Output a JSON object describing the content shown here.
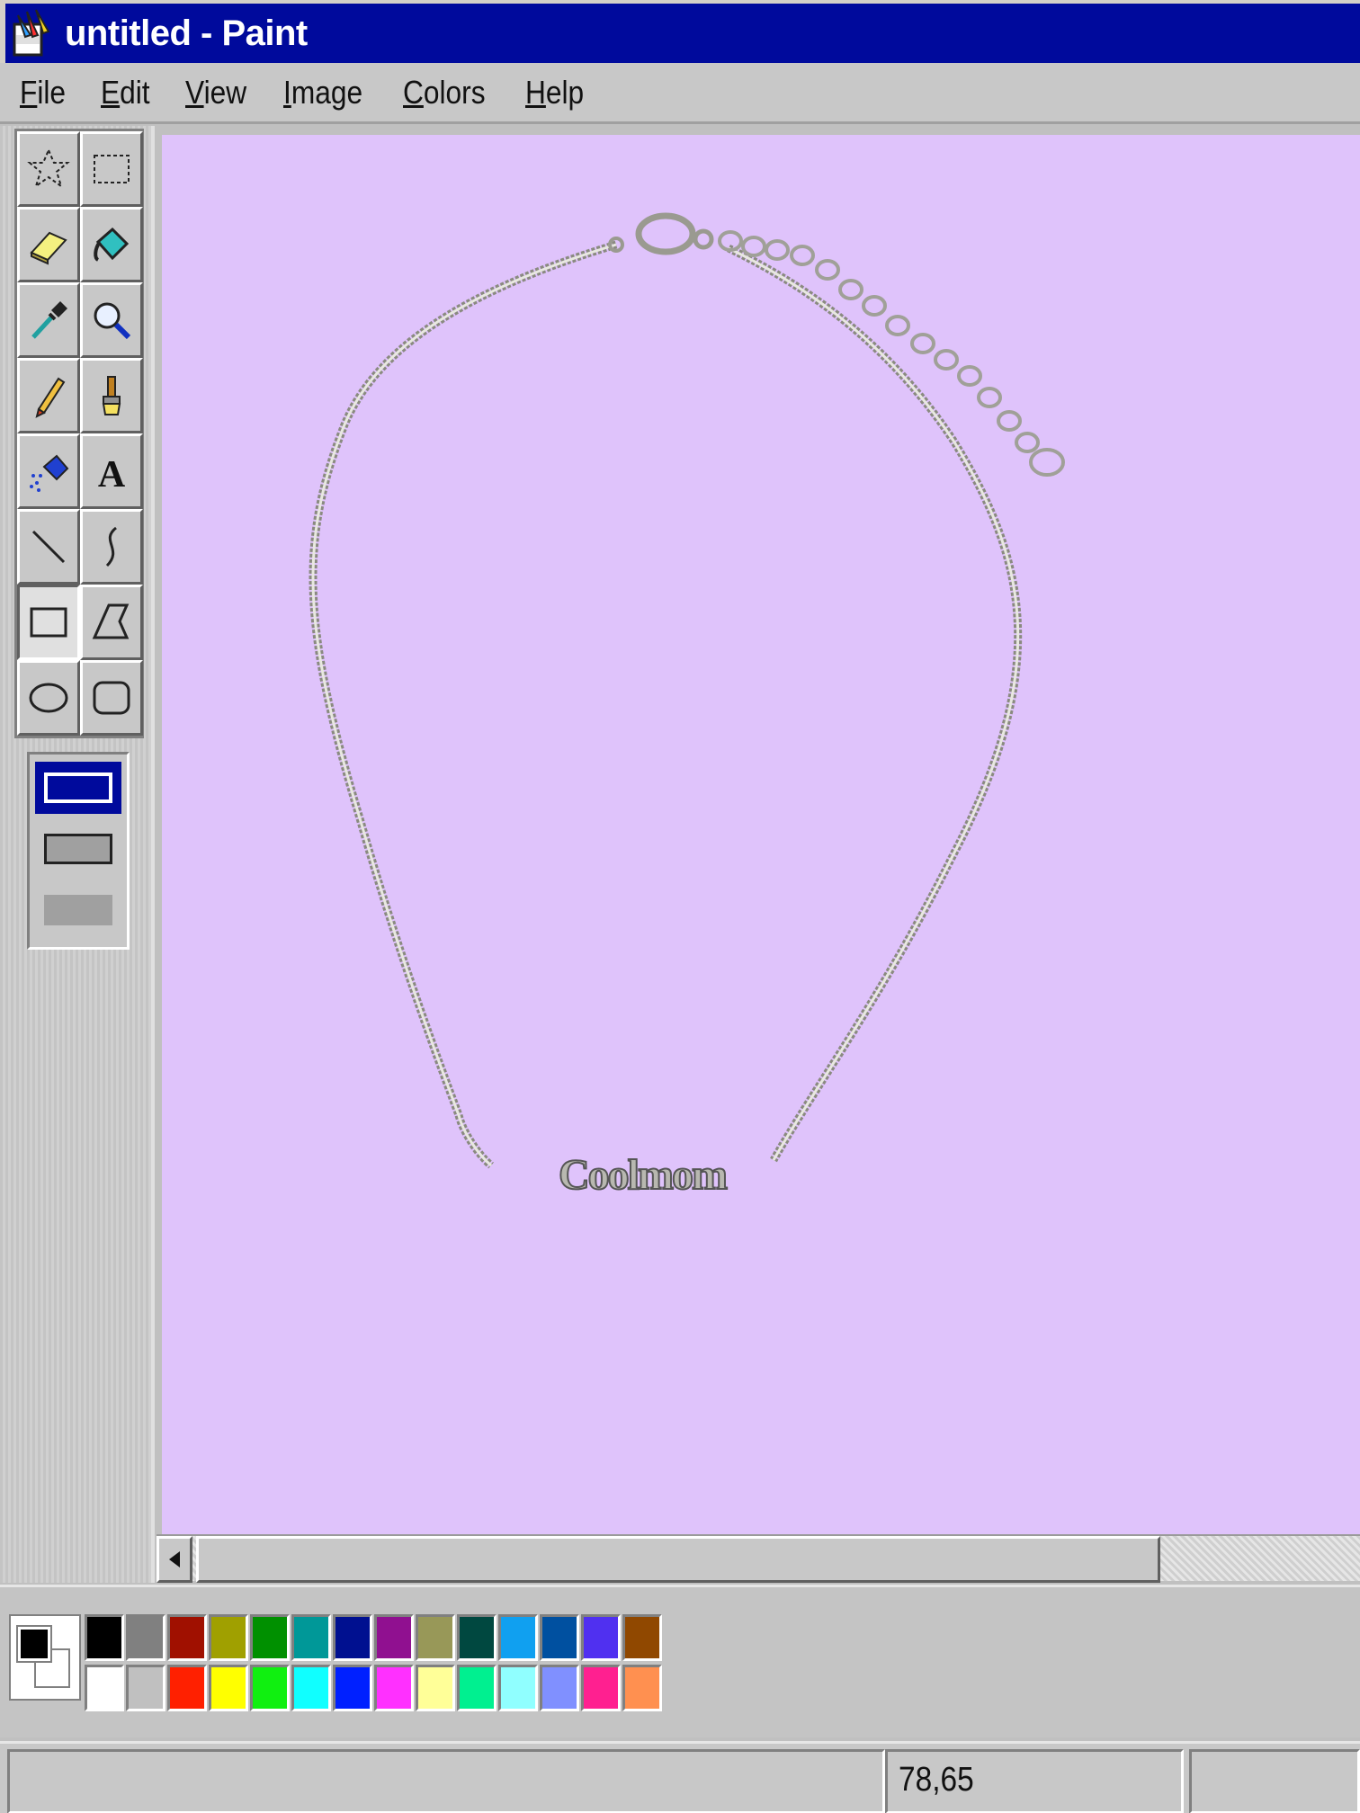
{
  "window": {
    "title": "untitled - Paint"
  },
  "menu": [
    {
      "label": "File",
      "accel": "F",
      "rest": "ile"
    },
    {
      "label": "Edit",
      "accel": "E",
      "rest": "dit"
    },
    {
      "label": "View",
      "accel": "V",
      "rest": "iew"
    },
    {
      "label": "Image",
      "accel": "I",
      "rest": "mage"
    },
    {
      "label": "Colors",
      "accel": "C",
      "rest": "olors"
    },
    {
      "label": "Help",
      "accel": "H",
      "rest": "elp"
    }
  ],
  "tools": [
    "free-form-select-icon",
    "select-icon",
    "eraser-icon",
    "fill-icon",
    "pick-color-icon",
    "magnifier-icon",
    "pencil-icon",
    "brush-icon",
    "airbrush-icon",
    "text-icon",
    "line-icon",
    "curve-icon",
    "rectangle-icon",
    "polygon-icon",
    "ellipse-icon",
    "rounded-rectangle-icon"
  ],
  "active_tool": "rectangle-icon",
  "canvas": {
    "background": "#dfc3fb",
    "pendant_text": "Coolmom"
  },
  "palette": {
    "foreground": "#000000",
    "background": "#ffffff",
    "top_row": [
      "#000000",
      "#808080",
      "#a01000",
      "#a0a000",
      "#009000",
      "#009898",
      "#001090",
      "#901090",
      "#989858",
      "#004840",
      "#10a0f0",
      "#0050a0",
      "#5030f0",
      "#904800"
    ],
    "bottom_row": [
      "#ffffff",
      "#c0c0c0",
      "#ff2000",
      "#ffff00",
      "#10f010",
      "#10ffff",
      "#0020ff",
      "#ff30ff",
      "#ffff98",
      "#00f090",
      "#90ffff",
      "#8090ff",
      "#ff2090",
      "#ff9050"
    ]
  },
  "status": {
    "coordinates": "78,65"
  }
}
